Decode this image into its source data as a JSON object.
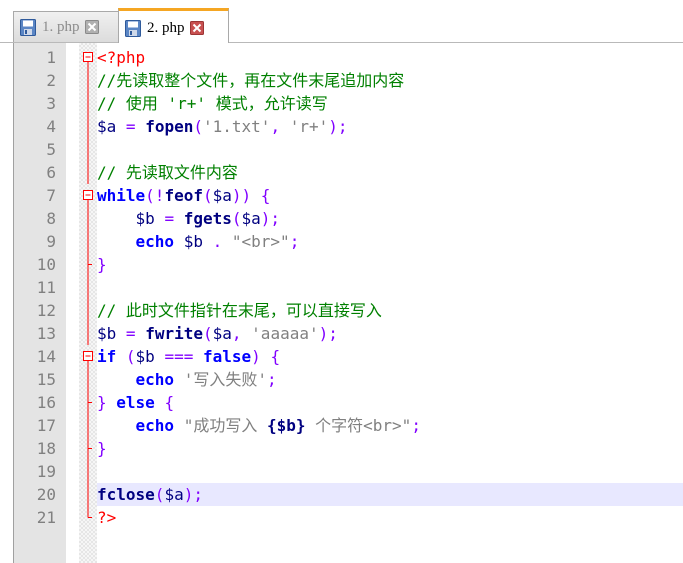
{
  "tabs": [
    {
      "label": "1. php",
      "active": false,
      "icon": "floppy-disk-icon",
      "close_icon": "close-icon"
    },
    {
      "label": "2. php",
      "active": true,
      "icon": "floppy-disk-icon",
      "close_icon": "close-icon"
    }
  ],
  "colors": {
    "accent_tab": "#f5a623",
    "current_line": "#e8e8ff",
    "php_tag": "#ff0000",
    "comment": "#008000",
    "keyword": "#0000ff",
    "operator": "#8000ff",
    "string": "#808080",
    "variable": "#000080",
    "fold_line": "#ff0000"
  },
  "editor": {
    "current_line": 20,
    "lines": [
      {
        "n": "1",
        "fold": "open",
        "tokens": [
          [
            "phptag",
            "<?php"
          ]
        ]
      },
      {
        "n": "2",
        "fold": "line",
        "tokens": [
          [
            "comment",
            "//先读取整个文件，再在文件末尾追加内容"
          ]
        ]
      },
      {
        "n": "3",
        "fold": "line",
        "tokens": [
          [
            "comment",
            "// 使用 'r+' 模式，允许读写"
          ]
        ]
      },
      {
        "n": "4",
        "fold": "line",
        "tokens": [
          [
            "var",
            "$a"
          ],
          [
            "plain",
            " "
          ],
          [
            "op",
            "="
          ],
          [
            "plain",
            " "
          ],
          [
            "func",
            "fopen"
          ],
          [
            "op",
            "("
          ],
          [
            "str",
            "'1.txt'"
          ],
          [
            "op",
            ","
          ],
          [
            "plain",
            " "
          ],
          [
            "str",
            "'r+'"
          ],
          [
            "op",
            ");"
          ]
        ]
      },
      {
        "n": "5",
        "fold": "line",
        "tokens": []
      },
      {
        "n": "6",
        "fold": "line",
        "tokens": [
          [
            "comment",
            "// 先读取文件内容"
          ]
        ]
      },
      {
        "n": "7",
        "fold": "open",
        "tokens": [
          [
            "kw",
            "while"
          ],
          [
            "op",
            "(!"
          ],
          [
            "func",
            "feof"
          ],
          [
            "op",
            "("
          ],
          [
            "var",
            "$a"
          ],
          [
            "op",
            "))"
          ],
          [
            "plain",
            " "
          ],
          [
            "op",
            "{"
          ]
        ]
      },
      {
        "n": "8",
        "fold": "line",
        "tokens": [
          [
            "plain",
            "    "
          ],
          [
            "var",
            "$b"
          ],
          [
            "plain",
            " "
          ],
          [
            "op",
            "="
          ],
          [
            "plain",
            " "
          ],
          [
            "func",
            "fgets"
          ],
          [
            "op",
            "("
          ],
          [
            "var",
            "$a"
          ],
          [
            "op",
            ");"
          ]
        ]
      },
      {
        "n": "9",
        "fold": "line",
        "tokens": [
          [
            "plain",
            "    "
          ],
          [
            "kw",
            "echo"
          ],
          [
            "plain",
            " "
          ],
          [
            "var",
            "$b"
          ],
          [
            "plain",
            " "
          ],
          [
            "op",
            "."
          ],
          [
            "plain",
            " "
          ],
          [
            "str",
            "\"<br>\""
          ],
          [
            "op",
            ";"
          ]
        ]
      },
      {
        "n": "10",
        "fold": "end",
        "tokens": [
          [
            "op",
            "}"
          ]
        ]
      },
      {
        "n": "11",
        "fold": "line",
        "tokens": []
      },
      {
        "n": "12",
        "fold": "line",
        "tokens": [
          [
            "comment",
            "// 此时文件指针在末尾，可以直接写入"
          ]
        ]
      },
      {
        "n": "13",
        "fold": "line",
        "tokens": [
          [
            "var",
            "$b"
          ],
          [
            "plain",
            " "
          ],
          [
            "op",
            "="
          ],
          [
            "plain",
            " "
          ],
          [
            "func",
            "fwrite"
          ],
          [
            "op",
            "("
          ],
          [
            "var",
            "$a"
          ],
          [
            "op",
            ","
          ],
          [
            "plain",
            " "
          ],
          [
            "str",
            "'aaaaa'"
          ],
          [
            "op",
            ");"
          ]
        ]
      },
      {
        "n": "14",
        "fold": "open",
        "tokens": [
          [
            "kw",
            "if"
          ],
          [
            "plain",
            " "
          ],
          [
            "op",
            "("
          ],
          [
            "var",
            "$b"
          ],
          [
            "plain",
            " "
          ],
          [
            "op",
            "==="
          ],
          [
            "plain",
            " "
          ],
          [
            "kw",
            "false"
          ],
          [
            "op",
            ")"
          ],
          [
            "plain",
            " "
          ],
          [
            "op",
            "{"
          ]
        ]
      },
      {
        "n": "15",
        "fold": "line",
        "tokens": [
          [
            "plain",
            "    "
          ],
          [
            "kw",
            "echo"
          ],
          [
            "plain",
            " "
          ],
          [
            "str",
            "'写入失败'"
          ],
          [
            "op",
            ";"
          ]
        ]
      },
      {
        "n": "16",
        "fold": "mid",
        "tokens": [
          [
            "op",
            "}"
          ],
          [
            "plain",
            " "
          ],
          [
            "kw",
            "else"
          ],
          [
            "plain",
            " "
          ],
          [
            "op",
            "{"
          ]
        ]
      },
      {
        "n": "17",
        "fold": "line",
        "tokens": [
          [
            "plain",
            "    "
          ],
          [
            "kw",
            "echo"
          ],
          [
            "plain",
            " "
          ],
          [
            "str",
            "\"成功写入 "
          ],
          [
            "interp",
            "{$b}"
          ],
          [
            "str",
            " 个字符<br>\""
          ],
          [
            "op",
            ";"
          ]
        ]
      },
      {
        "n": "18",
        "fold": "end",
        "tokens": [
          [
            "op",
            "}"
          ]
        ]
      },
      {
        "n": "19",
        "fold": "line",
        "tokens": []
      },
      {
        "n": "20",
        "fold": "line",
        "tokens": [
          [
            "func",
            "fclose"
          ],
          [
            "op",
            "("
          ],
          [
            "var",
            "$a"
          ],
          [
            "op",
            ");"
          ]
        ]
      },
      {
        "n": "21",
        "fold": "last",
        "tokens": [
          [
            "phptag",
            "?>"
          ]
        ]
      }
    ]
  }
}
